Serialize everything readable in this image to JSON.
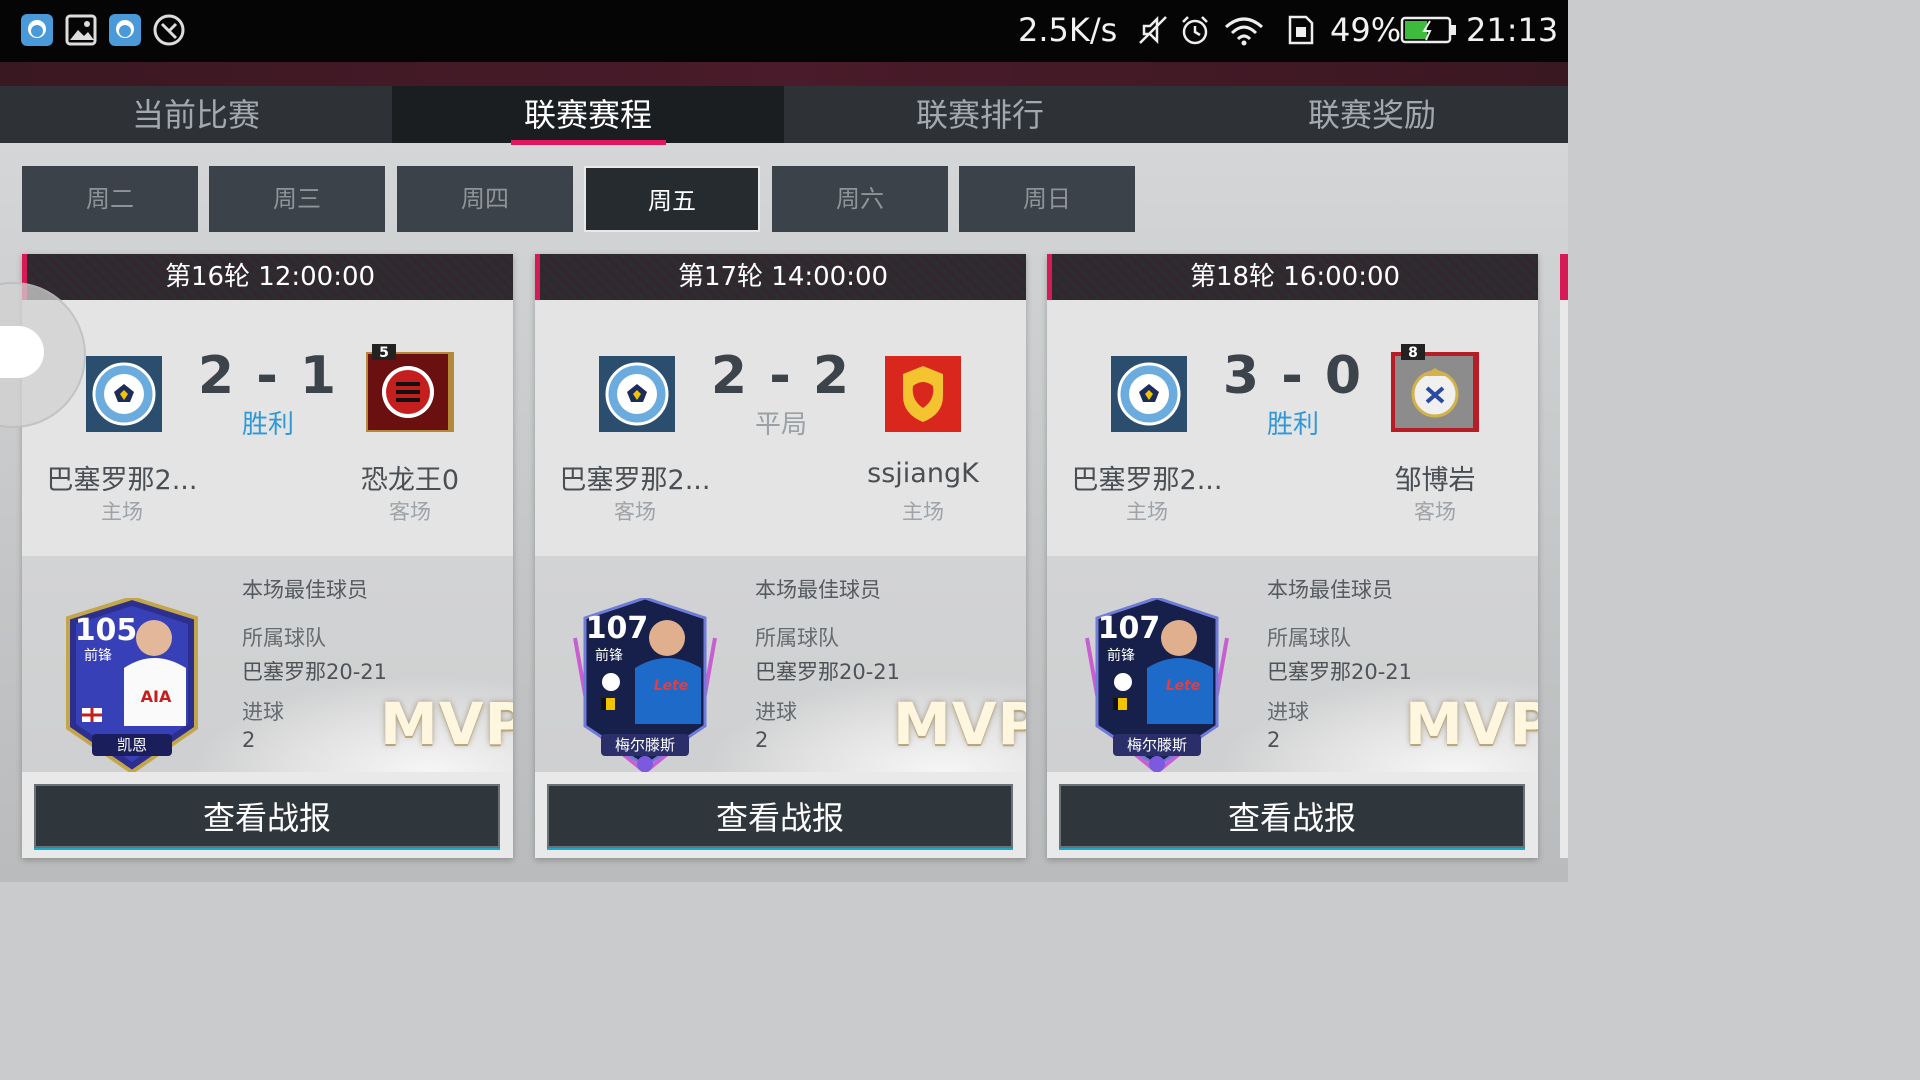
{
  "statusbar": {
    "net_speed": "2.5K/s",
    "battery_pct": "49%",
    "time": "21:13",
    "left_icons": [
      "qq-icon",
      "gallery-icon",
      "qq-icon-2",
      "vpn-icon"
    ],
    "right_icons": [
      "mute-icon",
      "alarm-icon",
      "wifi-icon",
      "sim-icon",
      "battery-icon"
    ]
  },
  "tabs": [
    "当前比赛",
    "联赛赛程",
    "联赛排行",
    "联赛奖励"
  ],
  "active_tab": 1,
  "days": [
    "周二",
    "周三",
    "周四",
    "周五",
    "周六",
    "周日"
  ],
  "active_day": 3,
  "cards": [
    {
      "header": "第16轮 12:00:00",
      "score": "2 - 1",
      "result": "胜利",
      "left_team": {
        "name": "巴塞罗那2...",
        "side": "主场"
      },
      "right_team": {
        "name": "恐龙王0",
        "side": "客场"
      },
      "mvp": {
        "title": "本场最佳球员",
        "team_label": "所属球队",
        "team_value": "巴塞罗那20-21",
        "goals_label": "进球",
        "goals_value": "2",
        "badge": "MVP",
        "player_rating": "105",
        "player_pos": "前锋",
        "player_name": "凯恩"
      },
      "button": "查看战报"
    },
    {
      "header": "第17轮 14:00:00",
      "score": "2 - 2",
      "result": "平局",
      "left_team": {
        "name": "巴塞罗那2...",
        "side": "客场"
      },
      "right_team": {
        "name": "ssjiangK",
        "side": "主场"
      },
      "mvp": {
        "title": "本场最佳球员",
        "team_label": "所属球队",
        "team_value": "巴塞罗那20-21",
        "goals_label": "进球",
        "goals_value": "2",
        "badge": "MVP",
        "player_rating": "107",
        "player_pos": "前锋",
        "player_name": "梅尔滕斯"
      },
      "button": "查看战报"
    },
    {
      "header": "第18轮 16:00:00",
      "score": "3 - 0",
      "result": "胜利",
      "left_team": {
        "name": "巴塞罗那2...",
        "side": "主场"
      },
      "right_team": {
        "name": "邹博岩",
        "side": "客场"
      },
      "mvp": {
        "title": "本场最佳球员",
        "team_label": "所属球队",
        "team_value": "巴塞罗那20-21",
        "goals_label": "进球",
        "goals_value": "2",
        "badge": "MVP",
        "player_rating": "107",
        "player_pos": "前锋",
        "player_name": "梅尔滕斯"
      },
      "button": "查看战报"
    }
  ],
  "crest_badges": {
    "card0_right": "5",
    "card2_right": "8"
  },
  "colors": {
    "accent": "#e2165f",
    "win": "#2e98d9",
    "draw": "#9aa0a4",
    "tab_bg": "#2e3236"
  }
}
